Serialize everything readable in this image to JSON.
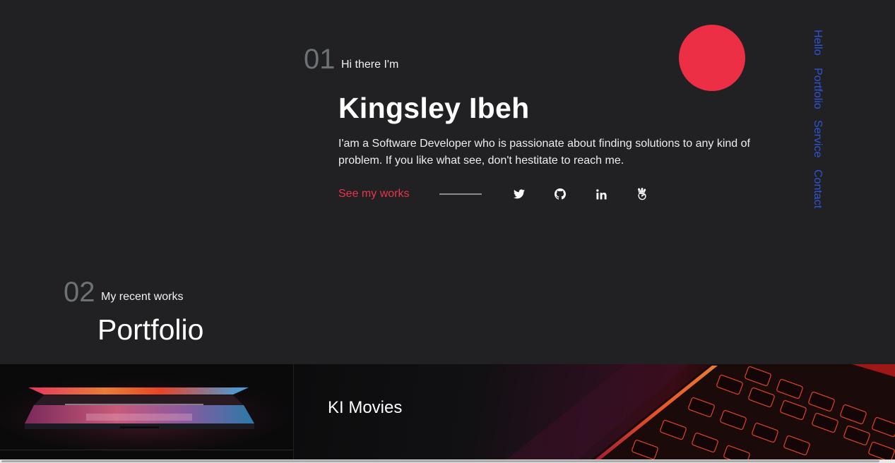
{
  "hero": {
    "number": "01",
    "greeting": "Hi there I'm",
    "name": "Kingsley Ibeh",
    "bio": "I'am a Software Developer who is passionate about finding solutions to any kind of problem. If you like what see, don't hestitate to reach me.",
    "cta_label": "See my works"
  },
  "social": [
    {
      "icon": "twitter-icon"
    },
    {
      "icon": "github-icon"
    },
    {
      "icon": "linkedin-icon"
    },
    {
      "icon": "angellist-icon"
    }
  ],
  "nav": {
    "items": [
      {
        "label": "Hello"
      },
      {
        "label": "Portfolio"
      },
      {
        "label": "Service"
      },
      {
        "label": "Contact"
      }
    ]
  },
  "portfolio": {
    "number": "02",
    "subtitle": "My recent works",
    "title": "Portfolio",
    "projects": [
      {
        "title": "KI Movies"
      }
    ]
  },
  "colors": {
    "background": "#212123",
    "accent_red": "#ec2f45",
    "nav_blue": "#2e54d6",
    "muted_number": "#6d7276"
  }
}
